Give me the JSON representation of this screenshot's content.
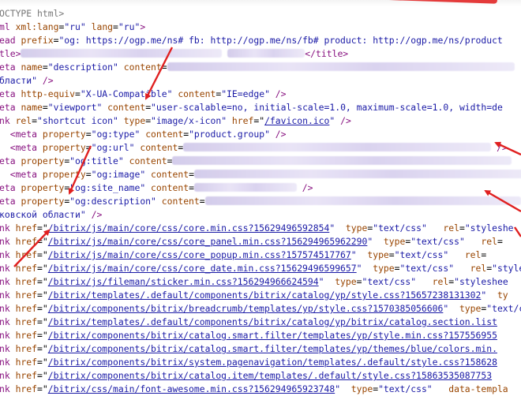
{
  "colors": {
    "tag": "#881280",
    "attr": "#994500",
    "value": "#1a1aa6",
    "arrow": "#e02020"
  },
  "lines": [
    [
      {
        "t": "cmt",
        "v": "OCTYPE html>"
      }
    ],
    [
      {
        "t": "tag",
        "v": "ml "
      },
      {
        "t": "attr",
        "v": "xml:lang"
      },
      {
        "t": "txt",
        "v": "="
      },
      {
        "t": "val",
        "v": "\"ru\""
      },
      {
        "t": "txt",
        "v": " "
      },
      {
        "t": "attr",
        "v": "lang"
      },
      {
        "t": "txt",
        "v": "="
      },
      {
        "t": "val",
        "v": "\"ru\""
      },
      {
        "t": "tag",
        "v": ">"
      }
    ],
    [
      {
        "t": "tag",
        "v": "ead "
      },
      {
        "t": "attr",
        "v": "prefix"
      },
      {
        "t": "txt",
        "v": "="
      },
      {
        "t": "val",
        "v": "\"og: https://ogp.me/ns# fb: http://ogp.me/ns/fb# product: http://ogp.me/ns/product"
      }
    ],
    [
      {
        "t": "tag",
        "v": "tle>"
      },
      {
        "t": "blur",
        "w": 255
      },
      {
        "t": "txt",
        "v": " "
      },
      {
        "t": "blur",
        "w": 98
      },
      {
        "t": "tag",
        "v": "</title>"
      }
    ],
    [
      {
        "t": "tag",
        "v": "eta "
      },
      {
        "t": "attr",
        "v": "name"
      },
      {
        "t": "txt",
        "v": "="
      },
      {
        "t": "val",
        "v": "\"description\""
      },
      {
        "t": "txt",
        "v": " "
      },
      {
        "t": "attr",
        "v": "content"
      },
      {
        "t": "txt",
        "v": "="
      },
      {
        "t": "blur",
        "w": 440
      }
    ],
    [
      {
        "t": "val",
        "v": "бласти\""
      },
      {
        "t": "tag",
        "v": " />"
      }
    ],
    [
      {
        "t": "tag",
        "v": "eta "
      },
      {
        "t": "attr",
        "v": "http-equiv"
      },
      {
        "t": "txt",
        "v": "="
      },
      {
        "t": "val",
        "v": "\"X-UA-Compatible\""
      },
      {
        "t": "txt",
        "v": " "
      },
      {
        "t": "attr",
        "v": "content"
      },
      {
        "t": "txt",
        "v": "="
      },
      {
        "t": "val",
        "v": "\"IE=edge\""
      },
      {
        "t": "tag",
        "v": " />"
      }
    ],
    [
      {
        "t": "tag",
        "v": "eta "
      },
      {
        "t": "attr",
        "v": "name"
      },
      {
        "t": "txt",
        "v": "="
      },
      {
        "t": "val",
        "v": "\"viewport\""
      },
      {
        "t": "txt",
        "v": " "
      },
      {
        "t": "attr",
        "v": "content"
      },
      {
        "t": "txt",
        "v": "="
      },
      {
        "t": "val",
        "v": "\"user-scalable=no, initial-scale=1.0, maximum-scale=1.0, width=de"
      }
    ],
    [
      {
        "t": "tag",
        "v": "nk "
      },
      {
        "t": "attr",
        "v": "rel"
      },
      {
        "t": "txt",
        "v": "="
      },
      {
        "t": "val",
        "v": "\"shortcut icon\""
      },
      {
        "t": "txt",
        "v": " "
      },
      {
        "t": "attr",
        "v": "type"
      },
      {
        "t": "txt",
        "v": "="
      },
      {
        "t": "val",
        "v": "\"image/x-icon\""
      },
      {
        "t": "txt",
        "v": " "
      },
      {
        "t": "attr",
        "v": "href"
      },
      {
        "t": "txt",
        "v": "=\""
      },
      {
        "t": "link",
        "v": "/favicon.ico"
      },
      {
        "t": "val",
        "v": "\""
      },
      {
        "t": "tag",
        "v": " />"
      }
    ],
    [
      {
        "t": "tag",
        "v": "  <meta "
      },
      {
        "t": "attr",
        "v": "property"
      },
      {
        "t": "txt",
        "v": "="
      },
      {
        "t": "val",
        "v": "\"og:type\""
      },
      {
        "t": "txt",
        "v": " "
      },
      {
        "t": "attr",
        "v": "content"
      },
      {
        "t": "txt",
        "v": "="
      },
      {
        "t": "val",
        "v": "\"product.group\""
      },
      {
        "t": "tag",
        "v": " />"
      }
    ],
    [
      {
        "t": "tag",
        "v": "  <meta "
      },
      {
        "t": "attr",
        "v": "property"
      },
      {
        "t": "txt",
        "v": "="
      },
      {
        "t": "val",
        "v": "\"og:url\""
      },
      {
        "t": "txt",
        "v": " "
      },
      {
        "t": "attr",
        "v": "content"
      },
      {
        "t": "txt",
        "v": "="
      },
      {
        "t": "blur",
        "w": 390
      },
      {
        "t": "tag",
        "v": " />"
      }
    ],
    [
      {
        "t": "tag",
        "v": "eta "
      },
      {
        "t": "attr",
        "v": "property"
      },
      {
        "t": "txt",
        "v": "="
      },
      {
        "t": "val",
        "v": "\"og:title\""
      },
      {
        "t": "txt",
        "v": " "
      },
      {
        "t": "attr",
        "v": "content"
      },
      {
        "t": "txt",
        "v": "="
      },
      {
        "t": "blur",
        "w": 430
      }
    ],
    [
      {
        "t": "tag",
        "v": "  <meta "
      },
      {
        "t": "attr",
        "v": "property"
      },
      {
        "t": "txt",
        "v": "="
      },
      {
        "t": "val",
        "v": "\"og:image\""
      },
      {
        "t": "txt",
        "v": " "
      },
      {
        "t": "attr",
        "v": "content"
      },
      {
        "t": "txt",
        "v": "="
      },
      {
        "t": "blur",
        "w": 420
      }
    ],
    [
      {
        "t": "tag",
        "v": "eta "
      },
      {
        "t": "attr",
        "v": "property"
      },
      {
        "t": "txt",
        "v": "="
      },
      {
        "t": "val",
        "v": "\"og:site_name\""
      },
      {
        "t": "txt",
        "v": " "
      },
      {
        "t": "attr",
        "v": "content"
      },
      {
        "t": "txt",
        "v": "="
      },
      {
        "t": "blur",
        "w": 130
      },
      {
        "t": "tag",
        "v": " />"
      }
    ],
    [
      {
        "t": "tag",
        "v": "eta "
      },
      {
        "t": "attr",
        "v": "property"
      },
      {
        "t": "txt",
        "v": "="
      },
      {
        "t": "val",
        "v": "\"og:description\""
      },
      {
        "t": "txt",
        "v": " "
      },
      {
        "t": "attr",
        "v": "content"
      },
      {
        "t": "txt",
        "v": "="
      },
      {
        "t": "blur",
        "w": 400
      }
    ],
    [
      {
        "t": "val",
        "v": "ковской области\""
      },
      {
        "t": "tag",
        "v": " />"
      }
    ],
    [
      {
        "t": "tag",
        "v": "nk "
      },
      {
        "t": "attr",
        "v": "href"
      },
      {
        "t": "txt",
        "v": "=\""
      },
      {
        "t": "link",
        "v": "/bitrix/js/main/core/css/core.min.css?15629496592854"
      },
      {
        "t": "val",
        "v": "\""
      },
      {
        "t": "txt",
        "v": "  "
      },
      {
        "t": "attr",
        "v": "type"
      },
      {
        "t": "txt",
        "v": "="
      },
      {
        "t": "val",
        "v": "\"text/css\""
      },
      {
        "t": "txt",
        "v": "   "
      },
      {
        "t": "attr",
        "v": "rel"
      },
      {
        "t": "txt",
        "v": "="
      },
      {
        "t": "val",
        "v": "\"styleshe"
      }
    ],
    [
      {
        "t": "tag",
        "v": "nk "
      },
      {
        "t": "attr",
        "v": "href"
      },
      {
        "t": "txt",
        "v": "=\""
      },
      {
        "t": "link",
        "v": "/bitrix/js/main/core/css/core_panel.min.css?156294965962290"
      },
      {
        "t": "val",
        "v": "\""
      },
      {
        "t": "txt",
        "v": "  "
      },
      {
        "t": "attr",
        "v": "type"
      },
      {
        "t": "txt",
        "v": "="
      },
      {
        "t": "val",
        "v": "\"text/css\""
      },
      {
        "t": "txt",
        "v": "   "
      },
      {
        "t": "attr",
        "v": "rel"
      },
      {
        "t": "txt",
        "v": "="
      }
    ],
    [
      {
        "t": "tag",
        "v": "nk "
      },
      {
        "t": "attr",
        "v": "href"
      },
      {
        "t": "txt",
        "v": "=\""
      },
      {
        "t": "link",
        "v": "/bitrix/js/main/core/css/core_popup.min.css?157574517767"
      },
      {
        "t": "val",
        "v": "\""
      },
      {
        "t": "txt",
        "v": "  "
      },
      {
        "t": "attr",
        "v": "type"
      },
      {
        "t": "txt",
        "v": "="
      },
      {
        "t": "val",
        "v": "\"text/css\""
      },
      {
        "t": "txt",
        "v": "   "
      },
      {
        "t": "attr",
        "v": "rel"
      },
      {
        "t": "txt",
        "v": "="
      }
    ],
    [
      {
        "t": "tag",
        "v": "nk "
      },
      {
        "t": "attr",
        "v": "href"
      },
      {
        "t": "txt",
        "v": "=\""
      },
      {
        "t": "link",
        "v": "/bitrix/js/main/core/css/core_date.min.css?15629496599657"
      },
      {
        "t": "val",
        "v": "\""
      },
      {
        "t": "txt",
        "v": "  "
      },
      {
        "t": "attr",
        "v": "type"
      },
      {
        "t": "txt",
        "v": "="
      },
      {
        "t": "val",
        "v": "\"text/css\""
      },
      {
        "t": "txt",
        "v": "   "
      },
      {
        "t": "attr",
        "v": "rel"
      },
      {
        "t": "txt",
        "v": "="
      },
      {
        "t": "val",
        "v": "\"styles"
      }
    ],
    [
      {
        "t": "tag",
        "v": "nk "
      },
      {
        "t": "attr",
        "v": "href"
      },
      {
        "t": "txt",
        "v": "=\""
      },
      {
        "t": "link",
        "v": "/bitrix/js/fileman/sticker.min.css?156294966624594"
      },
      {
        "t": "val",
        "v": "\""
      },
      {
        "t": "txt",
        "v": "  "
      },
      {
        "t": "attr",
        "v": "type"
      },
      {
        "t": "txt",
        "v": "="
      },
      {
        "t": "val",
        "v": "\"text/css\""
      },
      {
        "t": "txt",
        "v": "   "
      },
      {
        "t": "attr",
        "v": "rel"
      },
      {
        "t": "txt",
        "v": "="
      },
      {
        "t": "val",
        "v": "\"styleshee"
      }
    ],
    [
      {
        "t": "tag",
        "v": "nk "
      },
      {
        "t": "attr",
        "v": "href"
      },
      {
        "t": "txt",
        "v": "=\""
      },
      {
        "t": "link",
        "v": "/bitrix/templates/.default/components/bitrix/catalog/yp/style.css?15657238131302"
      },
      {
        "t": "val",
        "v": "\""
      },
      {
        "t": "txt",
        "v": "  "
      },
      {
        "t": "attr",
        "v": "ty"
      }
    ],
    [
      {
        "t": "tag",
        "v": "nk "
      },
      {
        "t": "attr",
        "v": "href"
      },
      {
        "t": "txt",
        "v": "=\""
      },
      {
        "t": "link",
        "v": "/bitrix/components/bitrix/breadcrumb/templates/yp/style.css?1570385056606"
      },
      {
        "t": "val",
        "v": "\""
      },
      {
        "t": "txt",
        "v": "  "
      },
      {
        "t": "attr",
        "v": "type"
      },
      {
        "t": "txt",
        "v": "="
      },
      {
        "t": "val",
        "v": "\"text/css\""
      }
    ],
    [
      {
        "t": "tag",
        "v": "nk "
      },
      {
        "t": "attr",
        "v": "href"
      },
      {
        "t": "txt",
        "v": "=\""
      },
      {
        "t": "link",
        "v": "/bitrix/templates/.default/components/bitrix/catalog/yp/bitrix/catalog.section.list"
      }
    ],
    [
      {
        "t": "tag",
        "v": "nk "
      },
      {
        "t": "attr",
        "v": "href"
      },
      {
        "t": "txt",
        "v": "=\""
      },
      {
        "t": "link",
        "v": "/bitrix/components/bitrix/catalog.smart.filter/templates/yp/style.min.css?157556955"
      }
    ],
    [
      {
        "t": "tag",
        "v": "nk "
      },
      {
        "t": "attr",
        "v": "href"
      },
      {
        "t": "txt",
        "v": "=\""
      },
      {
        "t": "link",
        "v": "/bitrix/components/bitrix/catalog.smart.filter/templates/yp/themes/blue/colors.min."
      }
    ],
    [
      {
        "t": "tag",
        "v": "nk "
      },
      {
        "t": "attr",
        "v": "href"
      },
      {
        "t": "txt",
        "v": "=\""
      },
      {
        "t": "link",
        "v": "/bitrix/components/bitrix/system.pagenavigation/templates/.default/style.css?158628"
      }
    ],
    [
      {
        "t": "tag",
        "v": "nk "
      },
      {
        "t": "attr",
        "v": "href"
      },
      {
        "t": "txt",
        "v": "=\""
      },
      {
        "t": "link",
        "v": "/bitrix/components/bitrix/catalog.item/templates/.default/style.css?15863535087753"
      }
    ],
    [
      {
        "t": "tag",
        "v": "nk "
      },
      {
        "t": "attr",
        "v": "href"
      },
      {
        "t": "txt",
        "v": "=\""
      },
      {
        "t": "link",
        "v": "/bitrix/css/main/font-awesome.min.css?156294965923748"
      },
      {
        "t": "val",
        "v": "\""
      },
      {
        "t": "txt",
        "v": "  "
      },
      {
        "t": "attr",
        "v": "type"
      },
      {
        "t": "txt",
        "v": "="
      },
      {
        "t": "val",
        "v": "\"text/css\""
      },
      {
        "t": "txt",
        "v": "   "
      },
      {
        "t": "attr",
        "v": "data-templa"
      }
    ]
  ]
}
